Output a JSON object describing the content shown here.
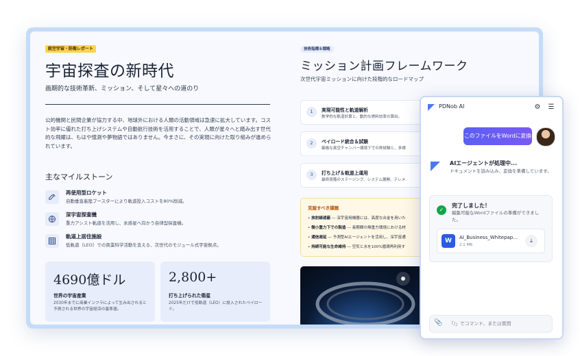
{
  "document": {
    "left": {
      "badge": "航空宇宙・防衛レポート",
      "title": "宇宙探査の新時代",
      "subtitle": "画期的な技術革新、ミッション、そして星々への道のり",
      "body": "公的機関と民間企業が協力する中、地球外における人類の活動領域は急速に拡大しています。コスト効率に優れた打ち上げシステムや自動航行技術を活用することで、人類が星々へと踏み出す世代的な飛躍は、もはや憶測や夢物語ではありません。今まさに、その実現に向けた取り組みが進められています。",
      "milestones_heading": "主なマイルストーン",
      "milestones": [
        {
          "icon": "rocket-icon",
          "title": "再使用型ロケット",
          "desc": "自動垂直着陸ブースターにより軌道投入コストを80%削減。"
        },
        {
          "icon": "globe-icon",
          "title": "深宇宙探査機",
          "desc": "重力アシスト軌道を活用し、氷惑星へ向かう自律型探査機。"
        },
        {
          "icon": "grid-icon",
          "title": "軌道上居住施設",
          "desc": "低軌道（LEO）での商業科学活動を支える、次世代のモジュール式宇宙拠点。"
        }
      ],
      "stats": [
        {
          "value": "4690億ドル",
          "label": "世界の宇宙産業",
          "desc": "2030年までに商業インフラによって生み出されると予測される世界の宇宙経済の基準値。"
        },
        {
          "value": "2,800+",
          "label": "打ち上げられた衛星",
          "desc": "2025年だけで低軌道（LEO）に投入されたペイロード。"
        }
      ]
    },
    "right": {
      "badge": "技術指標＆戦略",
      "title": "ミッション計画フレームワーク",
      "subtitle": "次世代宇宙ミッションに向けた段階的なロードマップ",
      "steps": [
        {
          "num": "1",
          "title": "実現可能性と軌道解析",
          "desc": "数学的な軌道計算と、動的な燃料効率の算出。"
        },
        {
          "num": "2",
          "title": "ペイロード統合＆試験",
          "desc": "厳格な真空チャンバー環境下での熱試験と、多様"
        },
        {
          "num": "3",
          "title": "打ち上げ＆軌道上運用",
          "desc": "最終段階のステージング、システム展開、テレメ"
        }
      ],
      "challenges": {
        "title": "克服すべき課題",
        "items": [
          {
            "bold": "放射線遮蔽",
            "text": " — 深宇宙用機器には、高度な合金を用いた"
          },
          {
            "bold": "微小重力下での製造",
            "text": " — 長期間の無重力環境における材"
          },
          {
            "bold": "通信遅延",
            "text": " — 予測型AIエージェントを活用し、深宇宙通"
          },
          {
            "bold": "持続可能な生命維持",
            "text": " — 空気と水を100%循環再利用す"
          }
        ]
      }
    }
  },
  "panel": {
    "app_name": "PDNob AI",
    "convert_button": "このファイルをWordに変換",
    "agent_title": "AIエージェントが処理中...",
    "agent_desc": "ドキュメントを読み込み、変換を準備しています。",
    "done_title": "完了しました！",
    "done_desc": "編集可能なWordファイルの準備ができました。",
    "file": {
      "icon_letter": "W",
      "name": "AI_Business_Whitepaper.docx",
      "size": "2.1 MB"
    },
    "input_placeholder": "「/」でコマンド、または質問",
    "accent": "#5b5ff2",
    "success": "#16a34a"
  }
}
